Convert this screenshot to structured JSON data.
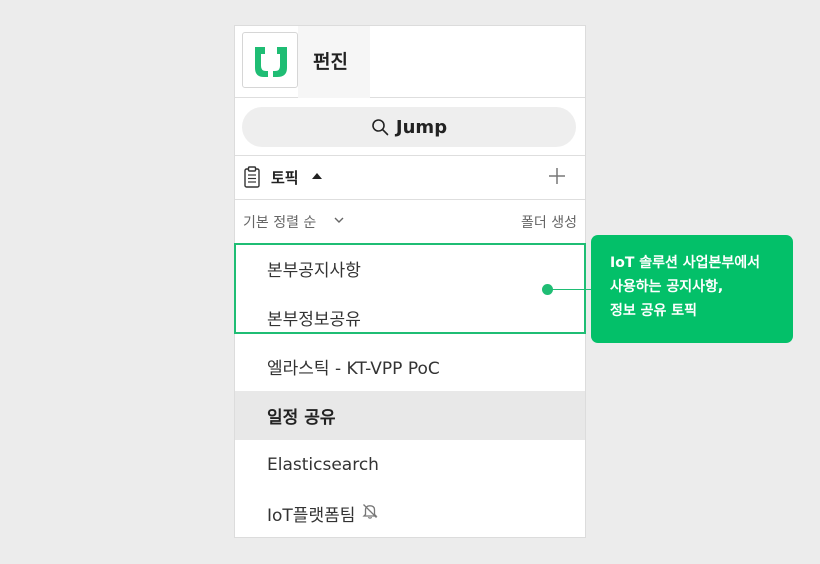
{
  "header": {
    "team_name": "펀진"
  },
  "jump": {
    "label": "Jump"
  },
  "topics": {
    "title": "토픽",
    "sort_label": "기본 정렬 순",
    "folder_label": "폴더 생성",
    "items": [
      {
        "label": "본부공지사항"
      },
      {
        "label": "본부정보공유"
      },
      {
        "label": "엘라스틱 - KT-VPP PoC"
      },
      {
        "label": "일정 공유"
      },
      {
        "label": "Elasticsearch"
      },
      {
        "label": "IoT플랫폼팀"
      }
    ]
  },
  "callout": {
    "lines": [
      "IoT 솔루션 사업본부에서",
      "사용하는 공지사항,",
      "정보 공유 토픽"
    ]
  },
  "colors": {
    "accent": "#03c069",
    "highlight": "#1fbd74",
    "logo": "#1fbd74"
  },
  "icons": {
    "logo": "brand-logo-icon",
    "search": "search-icon",
    "clipboard": "clipboard-icon",
    "add": "plus-icon",
    "sort": "chevron-down-icon",
    "bell": "bell-off-icon"
  }
}
